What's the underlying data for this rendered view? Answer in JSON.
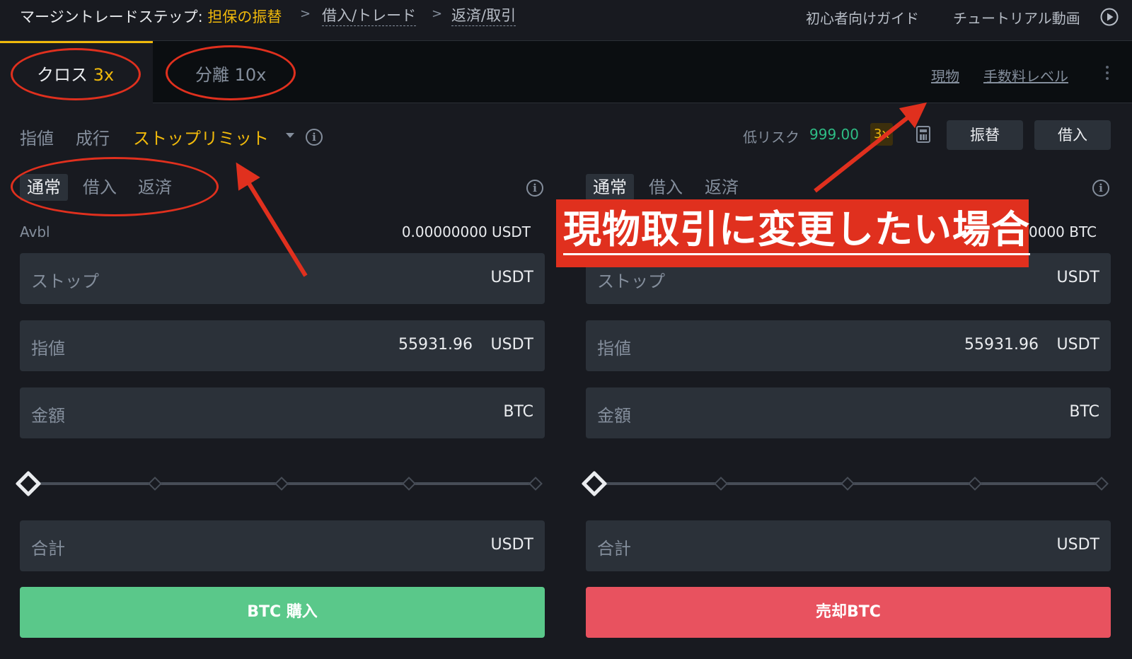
{
  "steps": {
    "prefix": "マージントレードステップ: ",
    "current": "担保の振替",
    "step2": "借入/トレード",
    "step3": "返済/取引",
    "separator": ">"
  },
  "header_links": {
    "guide": "初心者向けガイド",
    "tutorial": "チュートリアル動画"
  },
  "mode_tabs": {
    "cross_label": "クロス",
    "cross_lev": "3x",
    "isolated_label": "分離",
    "isolated_lev": "10x"
  },
  "right_links": {
    "spot": "現物",
    "fee_level": "手数料レベル"
  },
  "order_types": {
    "limit": "指値",
    "market": "成行",
    "stop_limit": "ストップリミット",
    "info_glyph": "i"
  },
  "risk": {
    "label": "低リスク",
    "value": "999.00",
    "leverage_badge": "3x"
  },
  "top_buttons": {
    "transfer": "振替",
    "borrow": "借入"
  },
  "buy_panel": {
    "sub_tabs": [
      "通常",
      "借入",
      "返済"
    ],
    "avbl_label": "Avbl",
    "avbl_value": "0.00000000 USDT",
    "stop_label": "ストップ",
    "stop_unit": "USDT",
    "limit_label": "指値",
    "limit_value": "55931.96",
    "limit_unit": "USDT",
    "amount_label": "金額",
    "amount_unit": "BTC",
    "total_label": "合計",
    "total_unit": "USDT",
    "slider_percent": 0,
    "button": "BTC 購入"
  },
  "sell_panel": {
    "sub_tabs": [
      "通常",
      "借入",
      "返済"
    ],
    "avbl_value_partial": "0000 BTC",
    "stop_label": "ストップ",
    "stop_unit": "USDT",
    "limit_label": "指値",
    "limit_value": "55931.96",
    "limit_unit": "USDT",
    "amount_label": "金額",
    "amount_unit": "BTC",
    "total_label": "合計",
    "total_unit": "USDT",
    "slider_percent": 0,
    "button": "売却BTC"
  },
  "annotation": {
    "text": "現物取引に変更したい場合",
    "color": "#e0301e"
  },
  "colors": {
    "background": "#181a20",
    "accent": "#f0b90b",
    "buy": "#5ac88a",
    "sell": "#e8525f",
    "risk": "#2ebd85"
  }
}
